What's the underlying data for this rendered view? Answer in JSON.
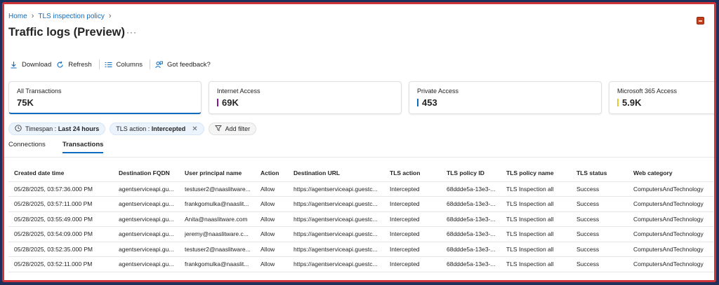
{
  "breadcrumb": [
    "Home",
    "TLS inspection policy"
  ],
  "page_title": "Traffic logs (Preview)",
  "title_more": "···",
  "toolbar": {
    "download": "Download",
    "refresh": "Refresh",
    "columns": "Columns",
    "feedback": "Got feedback?"
  },
  "cards": [
    {
      "label": "All Transactions",
      "value": "75K",
      "accent": ""
    },
    {
      "label": "Internet Access",
      "value": "69K",
      "accent": "#881798"
    },
    {
      "label": "Private Access",
      "value": "453",
      "accent": "#0f6cbd"
    },
    {
      "label": "Microsoft 365 Access",
      "value": "5.9K",
      "accent": "#e3c93a"
    }
  ],
  "filters": {
    "timespan_label": "Timespan : ",
    "timespan_value": "Last 24 hours",
    "tls_action_label": "TLS action : ",
    "tls_action_value": "Intercepted",
    "add_filter": "Add filter"
  },
  "tabs": [
    "Connections",
    "Transactions"
  ],
  "table": {
    "columns": [
      "Created date time",
      "Destination FQDN",
      "User principal name",
      "Action",
      "Destination URL",
      "TLS action",
      "TLS policy ID",
      "TLS policy name",
      "TLS status",
      "Web category"
    ],
    "rows": [
      [
        "05/28/2025, 03:57:36.000 PM",
        "agentserviceapi.gu...",
        "testuser2@naaslitware...",
        "Allow",
        "https://agentserviceapi.guestc...",
        "Intercepted",
        "68ddde5a-13e3-...",
        "TLS Inspection all",
        "Success",
        "ComputersAndTechnology"
      ],
      [
        "05/28/2025, 03:57:11.000 PM",
        "agentserviceapi.gu...",
        "frankgomulka@naaslit...",
        "Allow",
        "https://agentserviceapi.guestc...",
        "Intercepted",
        "68ddde5a-13e3-...",
        "TLS Inspection all",
        "Success",
        "ComputersAndTechnology"
      ],
      [
        "05/28/2025, 03:55:49.000 PM",
        "agentserviceapi.gu...",
        "Anita@naaslitware.com",
        "Allow",
        "https://agentserviceapi.guestc...",
        "Intercepted",
        "68ddde5a-13e3-...",
        "TLS Inspection all",
        "Success",
        "ComputersAndTechnology"
      ],
      [
        "05/28/2025, 03:54:09.000 PM",
        "agentserviceapi.gu...",
        "jeremy@naaslitware.c...",
        "Allow",
        "https://agentserviceapi.guestc...",
        "Intercepted",
        "68ddde5a-13e3-...",
        "TLS Inspection all",
        "Success",
        "ComputersAndTechnology"
      ],
      [
        "05/28/2025, 03:52:35.000 PM",
        "agentserviceapi.gu...",
        "testuser2@naaslitware...",
        "Allow",
        "https://agentserviceapi.guestc...",
        "Intercepted",
        "68ddde5a-13e3-...",
        "TLS Inspection all",
        "Success",
        "ComputersAndTechnology"
      ],
      [
        "05/28/2025, 03:52:11.000 PM",
        "agentserviceapi.gu...",
        "frankgomulka@naaslit...",
        "Allow",
        "https://agentserviceapi.guestc...",
        "Intercepted",
        "68ddde5a-13e3-...",
        "TLS Inspection all",
        "Success",
        "ComputersAndTechnology"
      ]
    ]
  },
  "colors": {
    "accent": "#0f6cbd",
    "frame_border": "#d13438",
    "background": "#1d2f5a"
  }
}
